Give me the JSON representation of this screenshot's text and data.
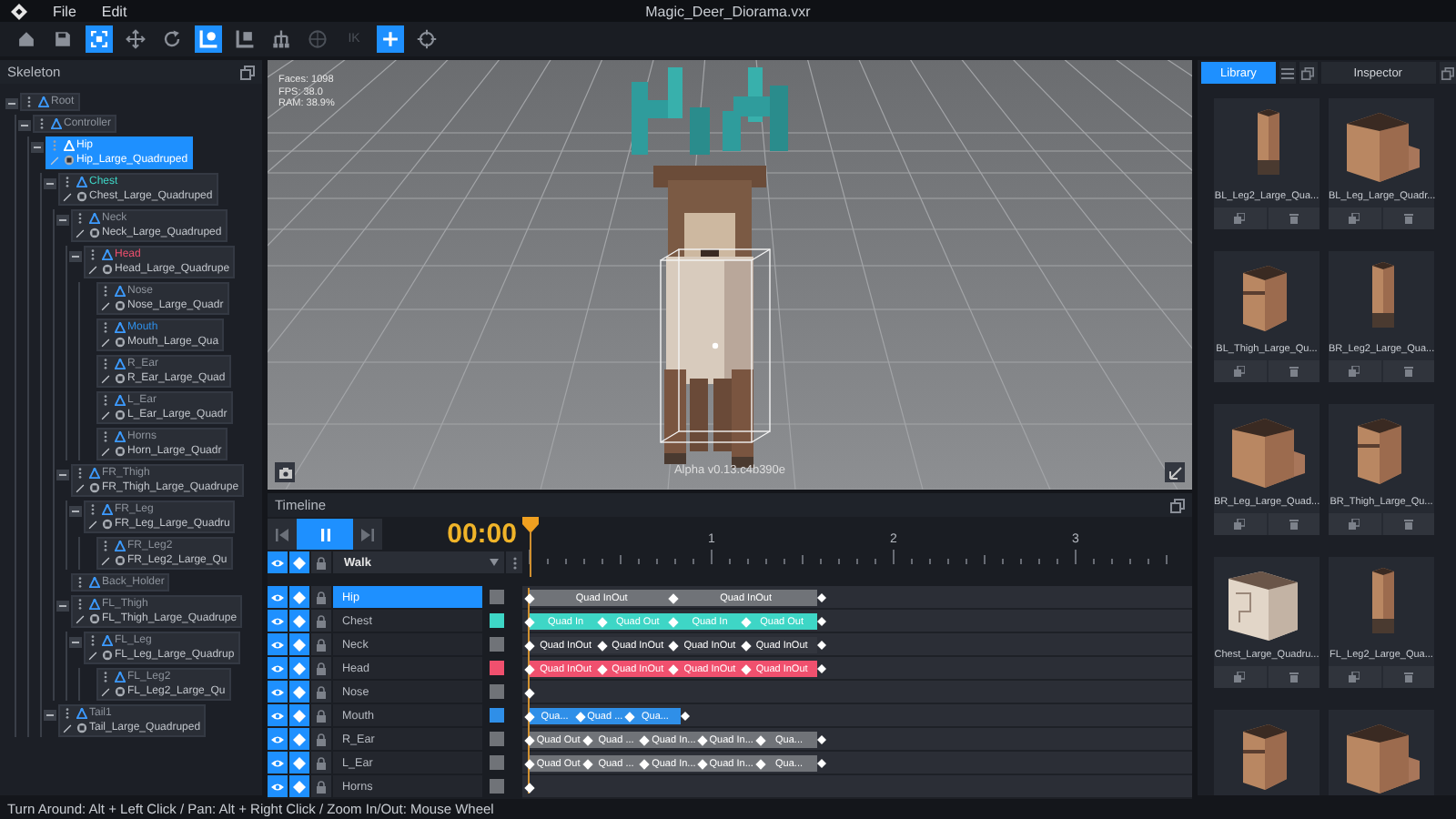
{
  "window": {
    "title": "Magic_Deer_Diorama.vxr"
  },
  "menu": [
    "File",
    "Edit"
  ],
  "toolbar": [
    {
      "kind": "home",
      "selected": false,
      "disabled": false
    },
    {
      "kind": "save",
      "selected": false,
      "disabled": false
    },
    {
      "kind": "fit",
      "selected": true,
      "disabled": false
    },
    {
      "kind": "move",
      "selected": false,
      "disabled": false
    },
    {
      "kind": "rotate",
      "selected": false,
      "disabled": false
    },
    {
      "kind": "bone",
      "selected": true,
      "disabled": false
    },
    {
      "kind": "bone-mesh",
      "selected": false,
      "disabled": false
    },
    {
      "kind": "hierarchy",
      "selected": false,
      "disabled": false
    },
    {
      "kind": "sphere",
      "selected": false,
      "disabled": true
    },
    {
      "kind": "ik",
      "label": "IK",
      "selected": false,
      "disabled": true
    },
    {
      "kind": "add",
      "selected": true,
      "disabled": false
    },
    {
      "kind": "target",
      "selected": false,
      "disabled": false
    }
  ],
  "skeleton": {
    "title": "Skeleton",
    "bones": [
      {
        "name": "Root",
        "selected": false,
        "expanded": true,
        "children": [
          {
            "name": "Controller",
            "selected": false,
            "expanded": true,
            "children": [
              {
                "name": "Hip",
                "mesh": "Hip_Large_Quadruped",
                "selected": true,
                "expanded": true,
                "children": [
                  {
                    "name": "Chest",
                    "mesh": "Chest_Large_Quadruped",
                    "color": "#3ed6c6",
                    "selected": false,
                    "expanded": true,
                    "children": [
                      {
                        "name": "Neck",
                        "mesh": "Neck_Large_Quadruped",
                        "selected": false,
                        "expanded": true,
                        "children": [
                          {
                            "name": "Head",
                            "mesh": "Head_Large_Quadrupe",
                            "color": "#f0506e",
                            "selected": false,
                            "expanded": true,
                            "children": [
                              {
                                "name": "Nose",
                                "mesh": "Nose_Large_Quadr",
                                "selected": false
                              },
                              {
                                "name": "Mouth",
                                "mesh": "Mouth_Large_Qua",
                                "color": "#2f8fe8",
                                "selected": false
                              },
                              {
                                "name": "R_Ear",
                                "mesh": "R_Ear_Large_Quad",
                                "selected": false
                              },
                              {
                                "name": "L_Ear",
                                "mesh": "L_Ear_Large_Quadr",
                                "selected": false
                              },
                              {
                                "name": "Horns",
                                "mesh": "Horn_Large_Quadr",
                                "selected": false
                              }
                            ]
                          }
                        ]
                      },
                      {
                        "name": "FR_Thigh",
                        "mesh": "FR_Thigh_Large_Quadrupe",
                        "selected": false,
                        "expanded": true,
                        "children": [
                          {
                            "name": "FR_Leg",
                            "mesh": "FR_Leg_Large_Quadru",
                            "selected": false,
                            "expanded": true,
                            "children": [
                              {
                                "name": "FR_Leg2",
                                "mesh": "FR_Leg2_Large_Qu",
                                "selected": false
                              }
                            ]
                          }
                        ]
                      },
                      {
                        "name": "Back_Holder",
                        "selected": false
                      },
                      {
                        "name": "FL_Thigh",
                        "mesh": "FL_Thigh_Large_Quadrupe",
                        "selected": false,
                        "expanded": true,
                        "children": [
                          {
                            "name": "FL_Leg",
                            "mesh": "FL_Leg_Large_Quadrup",
                            "selected": false,
                            "expanded": true,
                            "children": [
                              {
                                "name": "FL_Leg2",
                                "mesh": "FL_Leg2_Large_Qu",
                                "selected": false
                              }
                            ]
                          }
                        ]
                      }
                    ]
                  },
                  {
                    "name": "Tail1",
                    "mesh": "Tail_Large_Quadruped",
                    "selected": false,
                    "expanded": true
                  }
                ]
              }
            ]
          }
        ]
      }
    ]
  },
  "viewport": {
    "stats": [
      "Faces: 1098",
      "FPS: 38.0",
      "RAM: 38.9%"
    ],
    "version": "Alpha v0.13.c4b390e"
  },
  "timeline": {
    "title": "Timeline",
    "time": "00:00",
    "playing": true,
    "ruler_labels": [
      "1",
      "2",
      "3"
    ],
    "animation": "Walk",
    "tracks": [
      {
        "name": "Hip",
        "color": "#707378",
        "selected": true,
        "visible": true,
        "keyed": true,
        "locked": false,
        "filled": true,
        "level": 0.44,
        "segments": [
          "Quad InOut",
          "Quad InOut"
        ]
      },
      {
        "name": "Chest",
        "color": "#3ed6c6",
        "selected": false,
        "visible": true,
        "keyed": true,
        "locked": false,
        "filled": true,
        "level": 0.44,
        "segments": [
          "Quad In",
          "Quad Out",
          "Quad In",
          "Quad Out"
        ]
      },
      {
        "name": "Neck",
        "color": "#707378",
        "selected": false,
        "visible": true,
        "keyed": true,
        "locked": false,
        "filled": false,
        "level": 0.44,
        "segments": [
          "Quad InOut",
          "Quad InOut",
          "Quad InOut",
          "Quad InOut"
        ]
      },
      {
        "name": "Head",
        "color": "#f0506e",
        "selected": false,
        "visible": true,
        "keyed": true,
        "locked": false,
        "filled": true,
        "level": 0.44,
        "segments": [
          "Quad InOut",
          "Quad InOut",
          "Quad InOut",
          "Quad InOut"
        ]
      },
      {
        "name": "Nose",
        "color": "#707378",
        "selected": false,
        "visible": true,
        "keyed": true,
        "locked": false
      },
      {
        "name": "Mouth",
        "color": "#2f8fe8",
        "selected": false,
        "visible": true,
        "keyed": true,
        "locked": false,
        "filled": true,
        "level": 0.23,
        "segments": [
          "Qua...",
          "Quad ...",
          "Qua..."
        ]
      },
      {
        "name": "R_Ear",
        "color": "#707378",
        "selected": false,
        "visible": true,
        "keyed": true,
        "locked": false,
        "filled": true,
        "level": 0.44,
        "segments": [
          "Quad Out",
          "Quad ...",
          "Quad In...",
          "Quad In...",
          "Qua..."
        ]
      },
      {
        "name": "L_Ear",
        "color": "#707378",
        "selected": false,
        "visible": true,
        "keyed": true,
        "locked": false,
        "filled": true,
        "level": 0.44,
        "segments": [
          "Quad Out",
          "Quad ...",
          "Quad In...",
          "Quad In...",
          "Qua..."
        ]
      },
      {
        "name": "Horns",
        "color": "#707378",
        "selected": false,
        "visible": true,
        "keyed": true,
        "locked": false
      }
    ]
  },
  "library": {
    "tabs": [
      {
        "label": "Library",
        "selected": true
      },
      {
        "label": "Inspector",
        "selected": false
      }
    ],
    "items": [
      {
        "name": "BL_Leg2_Large_Qua...",
        "kind": "leg"
      },
      {
        "name": "BL_Leg_Large_Quadr...",
        "kind": "block"
      },
      {
        "name": "BL_Thigh_Large_Qu...",
        "kind": "thigh"
      },
      {
        "name": "BR_Leg2_Large_Qua...",
        "kind": "leg"
      },
      {
        "name": "BR_Leg_Large_Quad...",
        "kind": "block"
      },
      {
        "name": "BR_Thigh_Large_Qu...",
        "kind": "thigh"
      },
      {
        "name": "Chest_Large_Quadru...",
        "kind": "chest"
      },
      {
        "name": "FL_Leg2_Large_Qua...",
        "kind": "leg"
      },
      {
        "kind": "thigh"
      },
      {
        "kind": "block"
      }
    ]
  },
  "status_bar": "Turn Around: Alt + Left Click / Pan: Alt + Right Click / Zoom In/Out: Mouse Wheel"
}
